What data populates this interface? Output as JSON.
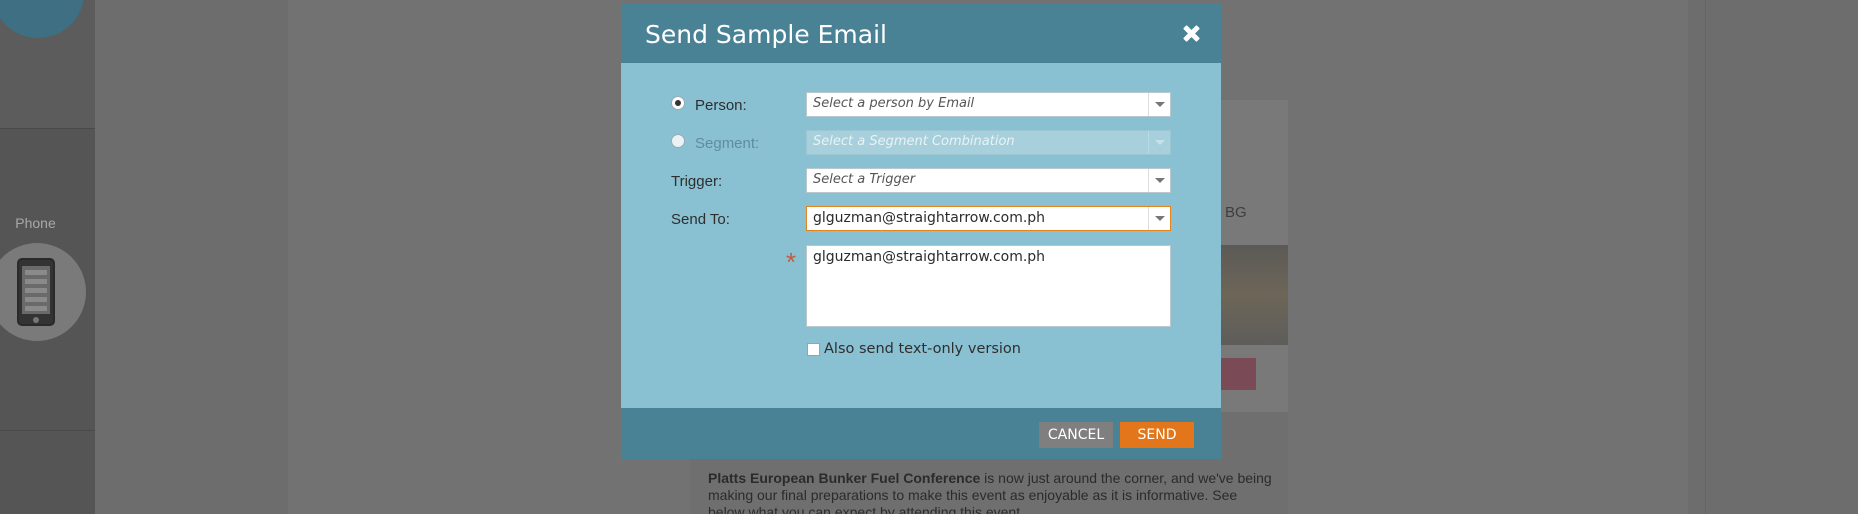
{
  "background": {
    "device_label": "Phone",
    "preview_bg_label": "BG",
    "preview_paragraph_bold": "Platts European Bunker Fuel Conference",
    "preview_paragraph_line1_rest": " is now just around the corner, and we've being",
    "preview_paragraph_line2": "making our final preparations to make this event as enjoyable as it is informative. See",
    "preview_paragraph_line3": "below what you can expect by attending this event"
  },
  "modal": {
    "title": "Send Sample Email",
    "person": {
      "label": "Person:",
      "placeholder": "Select a person by Email",
      "selected": true
    },
    "segment": {
      "label": "Segment:",
      "placeholder": "Select a Segment Combination",
      "disabled": true
    },
    "trigger": {
      "label": "Trigger:",
      "placeholder": "Select a Trigger"
    },
    "send_to": {
      "label": "Send To:",
      "value": "glguzman@straightarrow.com.ph"
    },
    "recipients_text": "glguzman@straightarrow.com.ph",
    "text_only_label": "Also send text-only version",
    "cancel_label": "CANCEL",
    "send_label": "SEND"
  },
  "colors": {
    "modal_header": "#4a8295",
    "modal_body": "#89c1d2",
    "send_button": "#e3761a",
    "cancel_button": "#7f7f7f"
  }
}
